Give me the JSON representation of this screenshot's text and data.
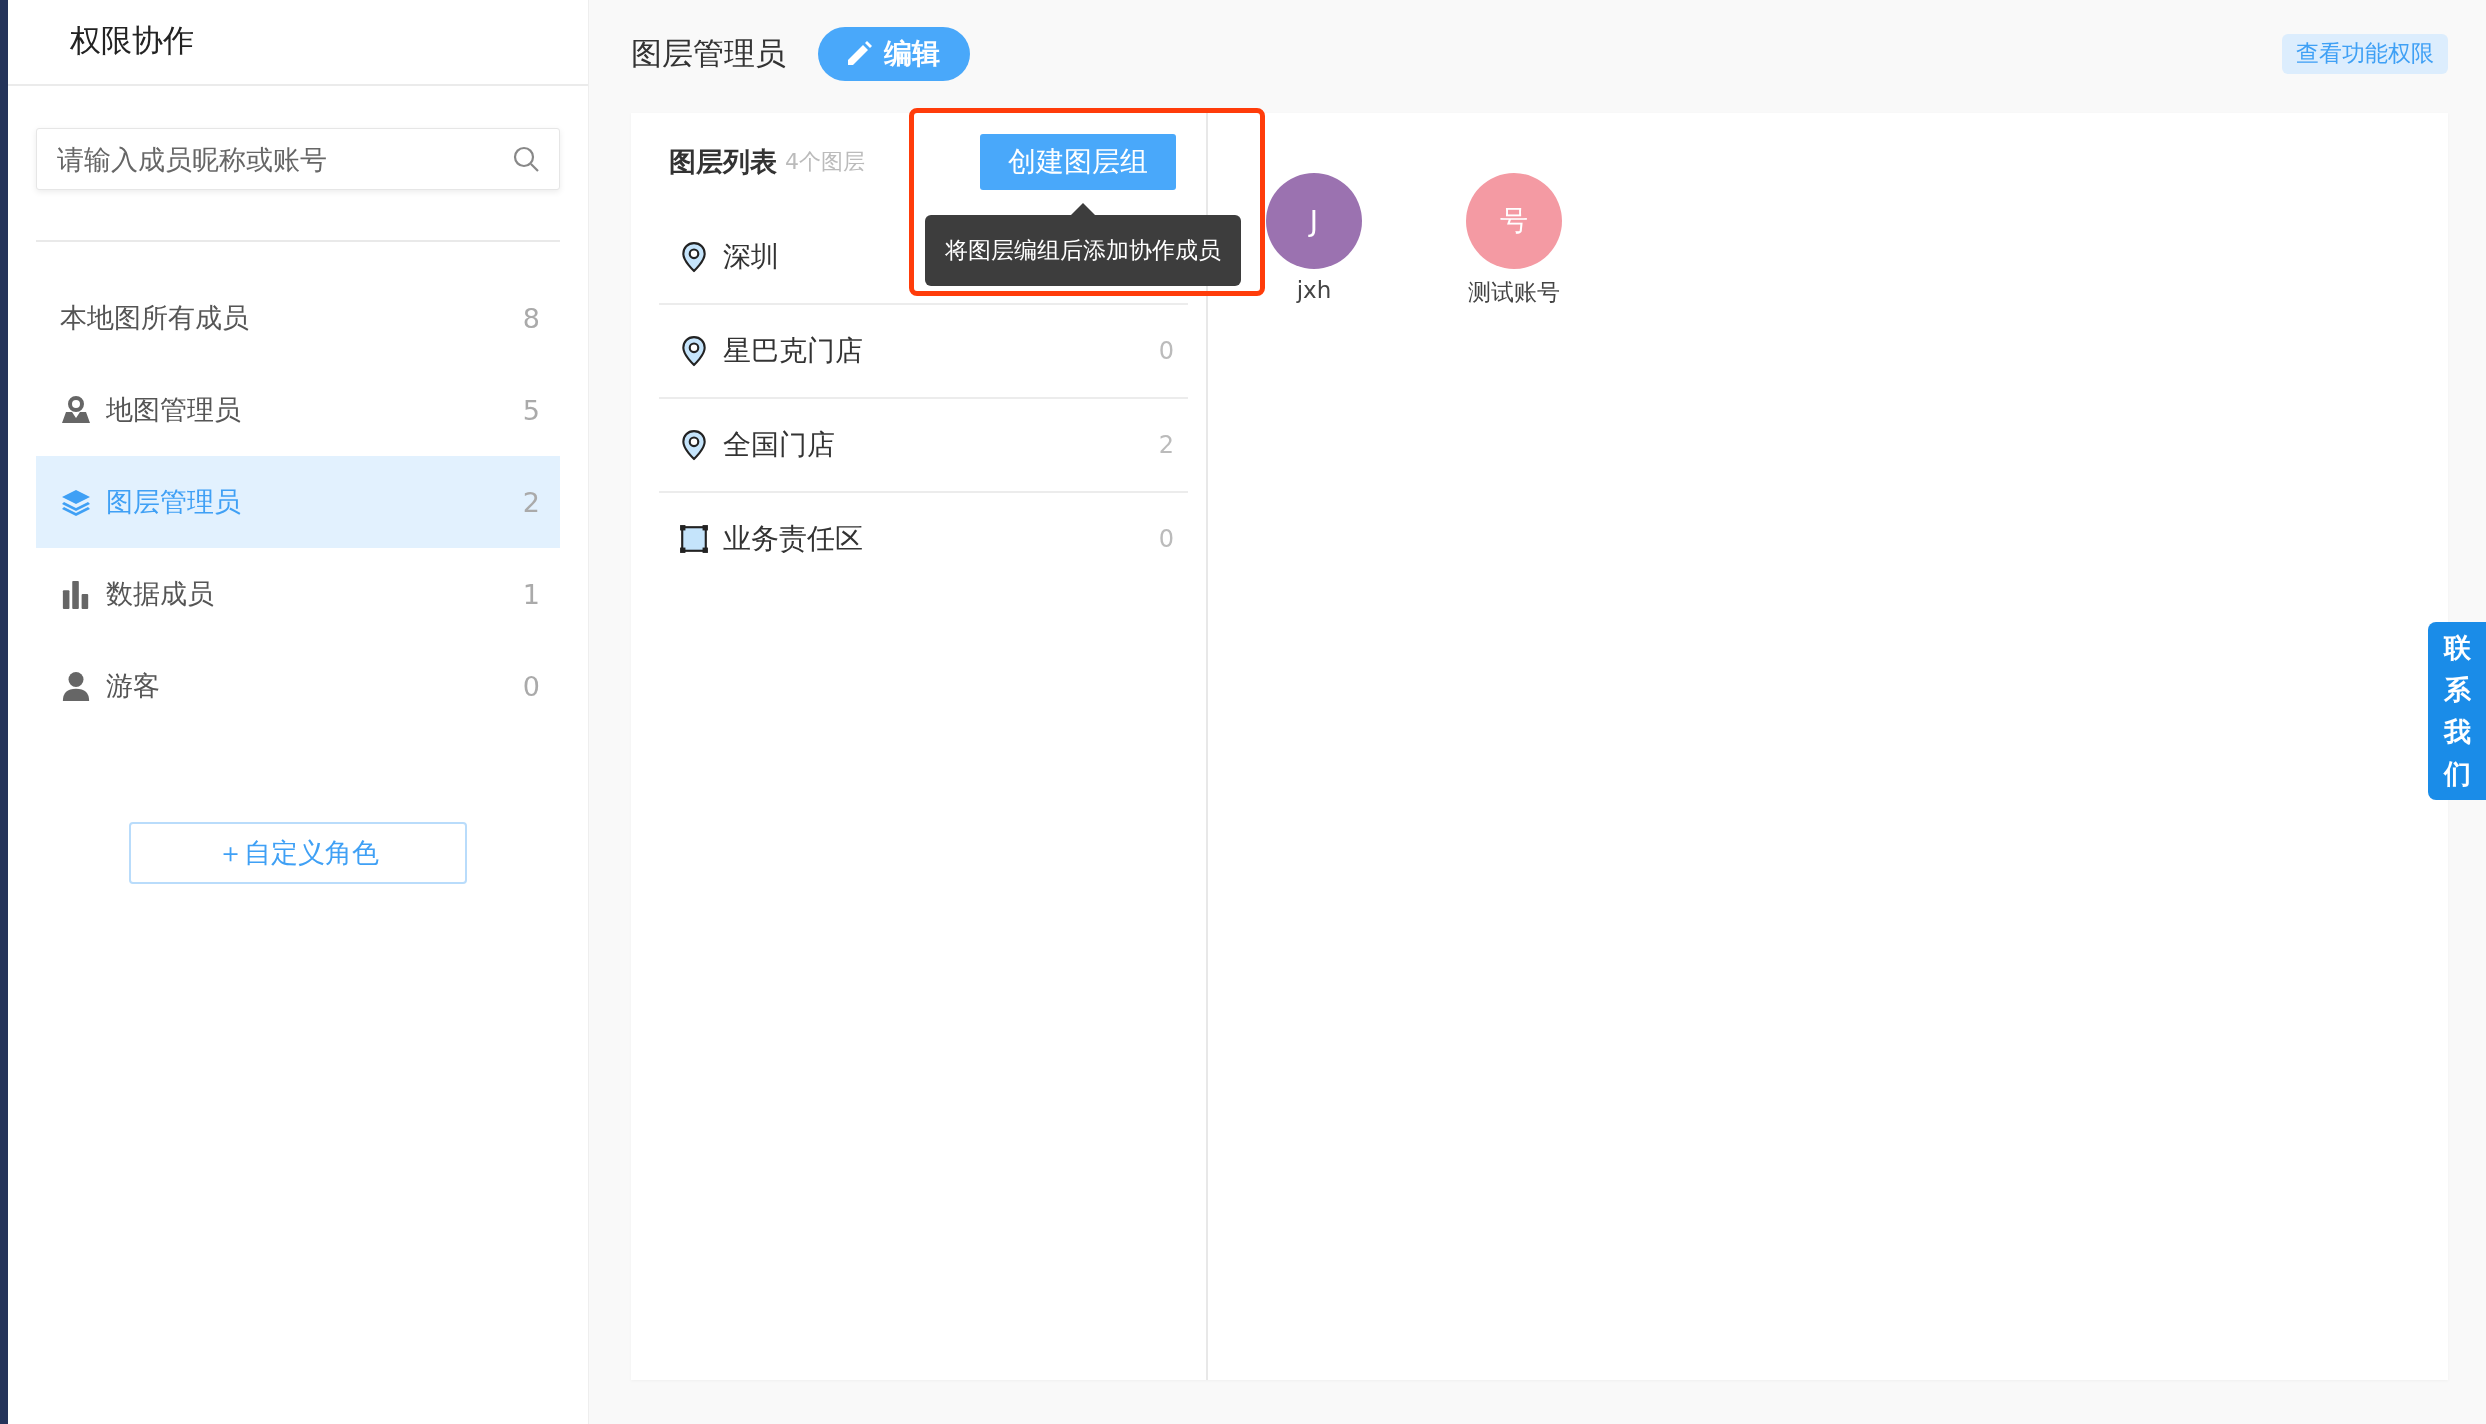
{
  "sidebar": {
    "title": "权限协作",
    "search": {
      "placeholder": "请输入成员昵称或账号"
    },
    "roles": [
      {
        "kind": "all",
        "label": "本地图所有成员",
        "count": "8",
        "selected": false
      },
      {
        "kind": "map-admin",
        "label": "地图管理员",
        "count": "5",
        "selected": false
      },
      {
        "kind": "layer-admin",
        "label": "图层管理员",
        "count": "2",
        "selected": true
      },
      {
        "kind": "data",
        "label": "数据成员",
        "count": "1",
        "selected": false
      },
      {
        "kind": "guest",
        "label": "游客",
        "count": "0",
        "selected": false
      }
    ],
    "add_role_button": "＋自定义角色"
  },
  "header": {
    "title": "图层管理员",
    "edit_button": "编辑",
    "permissions_button": "查看功能权限"
  },
  "layer_panel": {
    "title": "图层列表",
    "count": "4个图层",
    "create_group_button": "创建图层组",
    "tooltip": "将图层编组后添加协作成员",
    "layers": [
      {
        "kind": "point",
        "name": "深圳"
      },
      {
        "kind": "point",
        "name": "星巴克门店",
        "count": "0"
      },
      {
        "kind": "point",
        "name": "全国门店",
        "count": "2"
      },
      {
        "kind": "area",
        "name": "业务责任区",
        "count": "0"
      }
    ]
  },
  "members": [
    {
      "initial": "J",
      "name": "jxh",
      "color": "#9b72b0"
    },
    {
      "initial": "号",
      "name": "测试账号",
      "color": "#f49aa3"
    }
  ],
  "contact_tab": "联系我们"
}
